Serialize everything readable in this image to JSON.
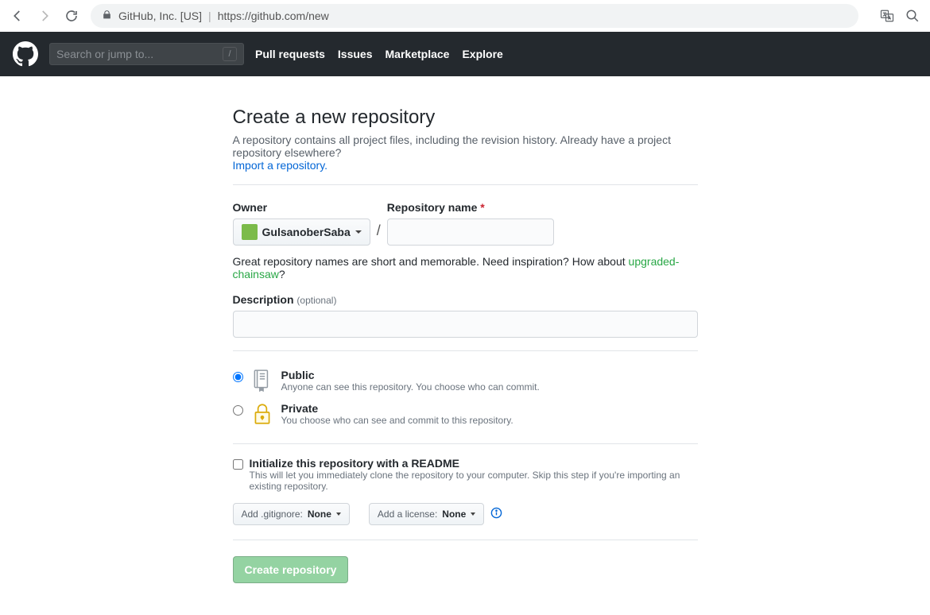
{
  "browser": {
    "identity": "GitHub, Inc. [US]",
    "url": "https://github.com/new"
  },
  "header": {
    "search_placeholder": "Search or jump to...",
    "nav": {
      "pull_requests": "Pull requests",
      "issues": "Issues",
      "marketplace": "Marketplace",
      "explore": "Explore"
    }
  },
  "page": {
    "title": "Create a new repository",
    "lead": "A repository contains all project files, including the revision history. Already have a project repository elsewhere?",
    "import_link": "Import a repository.",
    "owner_label": "Owner",
    "owner_name": "GulsanoberSaba",
    "slash": "/",
    "repo_name_label": "Repository name",
    "helper_pre": "Great repository names are short and memorable. Need inspiration? How about ",
    "helper_suggestion": "upgraded-chainsaw",
    "helper_post": "?",
    "description_label": "Description",
    "description_optional": "(optional)",
    "public_title": "Public",
    "public_sub": "Anyone can see this repository. You choose who can commit.",
    "private_title": "Private",
    "private_sub": "You choose who can see and commit to this repository.",
    "readme_title": "Initialize this repository with a README",
    "readme_sub": "This will let you immediately clone the repository to your computer. Skip this step if you're importing an existing repository.",
    "gitignore_label": "Add .gitignore:",
    "gitignore_value": "None",
    "license_label": "Add a license:",
    "license_value": "None",
    "create_btn": "Create repository"
  }
}
